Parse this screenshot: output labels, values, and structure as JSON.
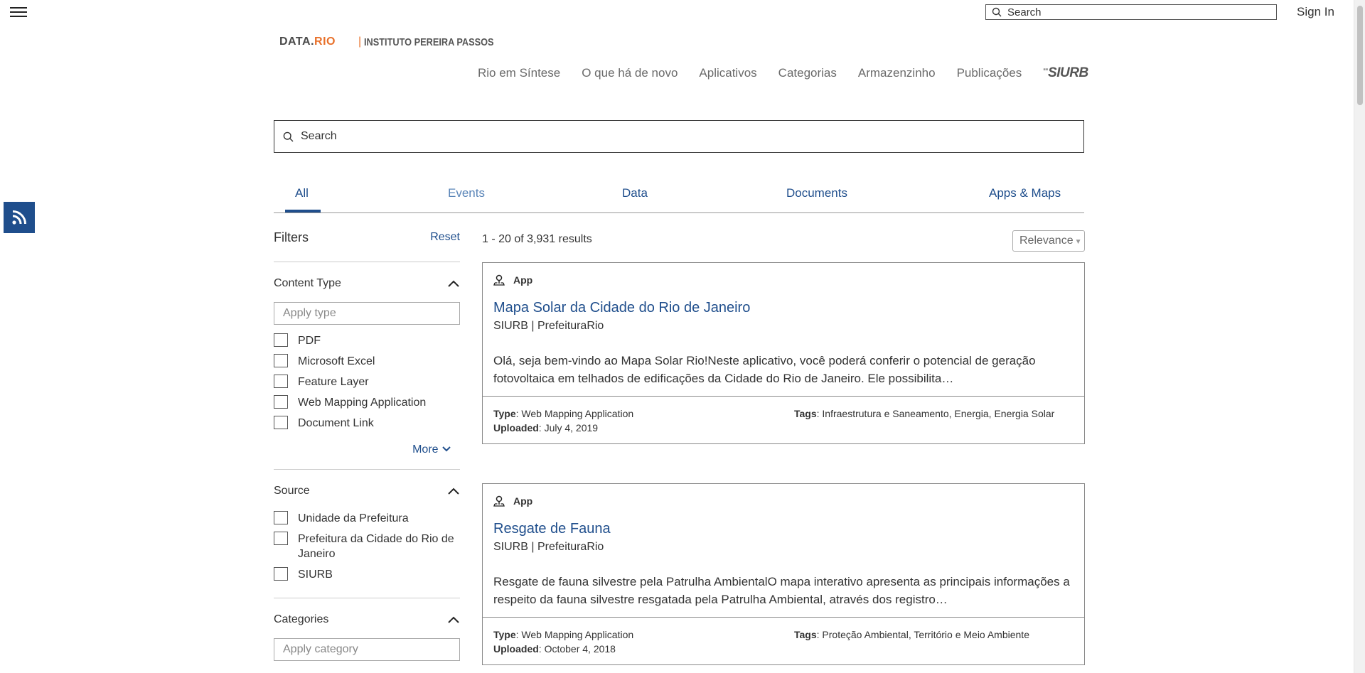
{
  "top": {
    "search_placeholder": "Search",
    "signin": "Sign In"
  },
  "brand": {
    "logo_data": "DATA.",
    "logo_rio": "RIO",
    "separator": "|",
    "institute": "INSTITUTO PEREIRA PASSOS"
  },
  "nav": {
    "items": [
      "Rio em Síntese",
      "O que há de novo",
      "Aplicativos",
      "Categorias",
      "Armazenzinho",
      "Publicações"
    ],
    "siurb": "SIURB"
  },
  "search": {
    "placeholder": "Search"
  },
  "tabs": [
    "All",
    "Events",
    "Data",
    "Documents",
    "Apps & Maps"
  ],
  "filters": {
    "title": "Filters",
    "reset": "Reset",
    "content_type": {
      "title": "Content Type",
      "placeholder": "Apply type",
      "options": [
        "PDF",
        "Microsoft Excel",
        "Feature Layer",
        "Web Mapping Application",
        "Document Link"
      ],
      "more": "More"
    },
    "source": {
      "title": "Source",
      "options": [
        "Unidade da Prefeitura",
        "Prefeitura da Cidade do Rio de Janeiro",
        "SIURB"
      ]
    },
    "categories": {
      "title": "Categories",
      "placeholder": "Apply category"
    }
  },
  "results": {
    "count": "1 - 20 of 3,931 results",
    "sort": "Relevance",
    "cards": [
      {
        "type": "App",
        "title": "Mapa Solar da Cidade do Rio de Janeiro",
        "owner": "SIURB | PrefeituraRio",
        "description": "Olá, seja bem-vindo ao Mapa Solar Rio!Neste aplicativo, você poderá conferir o potencial de geração fotovoltaica em telhados de edificações da Cidade do Rio de Janeiro. Ele possibilita…",
        "type_label": "Type",
        "type_value": "Web Mapping Application",
        "uploaded_label": "Uploaded",
        "uploaded_value": "July 4, 2019",
        "tags_label": "Tags",
        "tags_value": "Infraestrutura e Saneamento, Energia, Energia Solar"
      },
      {
        "type": "App",
        "title": "Resgate de Fauna",
        "owner": "SIURB | PrefeituraRio",
        "description": "Resgate de fauna silvestre pela Patrulha AmbientalO mapa interativo apresenta as principais informações a respeito da fauna silvestre resgatada pela Patrulha Ambiental, através dos registro…",
        "type_label": "Type",
        "type_value": "Web Mapping Application",
        "uploaded_label": "Uploaded",
        "uploaded_value": "October 4, 2018",
        "tags_label": "Tags",
        "tags_value": "Proteção Ambiental, Território e Meio Ambiente"
      }
    ]
  },
  "colors": {
    "accent": "#1f4e8c",
    "brand_orange": "#e8702a"
  },
  "icons": {
    "menu": "hamburger-icon",
    "search": "search-icon",
    "rss": "rss-icon",
    "app": "map-pin-icon",
    "chevron_up": "chevron-up-icon",
    "chevron_down": "chevron-down-icon"
  }
}
